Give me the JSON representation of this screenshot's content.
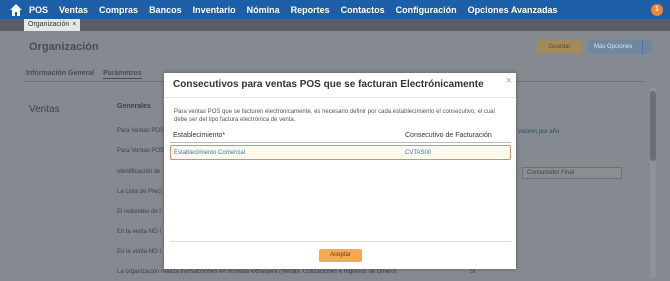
{
  "nav": {
    "items": [
      "POS",
      "Ventas",
      "Compras",
      "Bancos",
      "Inventario",
      "Nómina",
      "Reportes",
      "Contactos",
      "Configuración",
      "Opciones Avanzadas"
    ],
    "notification_count": "1"
  },
  "tab": {
    "label": "Organización",
    "close": "×"
  },
  "page": {
    "title": "Organización",
    "save_label": "Guardar",
    "more_label": "Más Opciones",
    "subtabs": [
      "Información General",
      "Parámetros"
    ],
    "side_title": "Ventas",
    "section_title": "Generales",
    "rows": [
      "Para Ventas POS",
      "Para Ventas POS",
      "Identificación de",
      "La Lista de Preci",
      "El redondeo de l",
      "En la venta NO I",
      "En la venta NO I",
      "La organización realiza transacciones en moneda extranjera (Ventas, Cotizaciones e Ingresos de Dinero)"
    ],
    "right_text": "valores por año",
    "consumer_value": "Consumidor Final",
    "yes_value": "Si"
  },
  "modal": {
    "title": "Consecutivos para ventas POS que se facturan Electrónicamente",
    "close": "×",
    "description": "Para ventas POS que se facturen electrónicamente, es necesario definir por cada establecimiento el consecutivo, el cual debe ser del tipo factura electrónica de venta.",
    "columns": [
      "Establecimiento*",
      "Consecutivo de Facturación"
    ],
    "rows": [
      {
        "establecimiento": "Establecimiento Comercial",
        "consecutivo": "CVTAS00"
      }
    ],
    "accept_label": "Aceptar"
  }
}
